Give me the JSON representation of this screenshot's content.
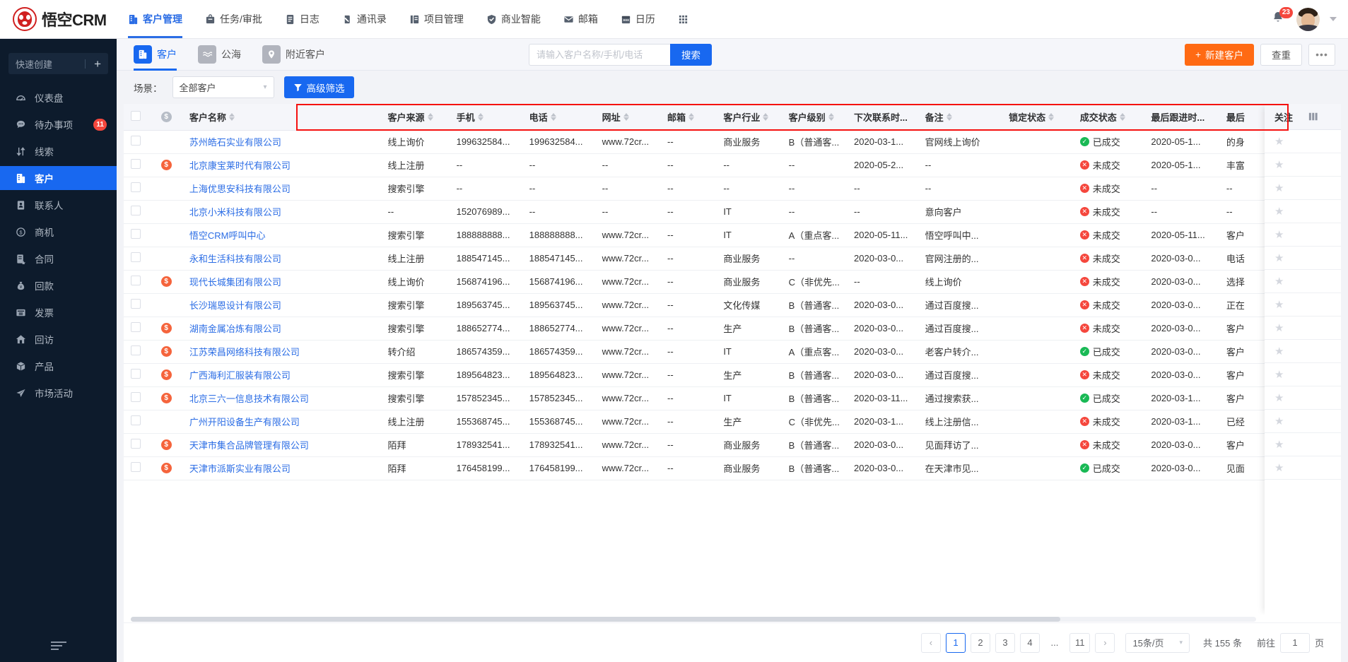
{
  "app": {
    "brand": "悟空CRM",
    "logo_color": "#d02020"
  },
  "topnav": {
    "items": [
      {
        "label": "客户管理",
        "icon": "customer-icon",
        "active": true
      },
      {
        "label": "任务/审批",
        "icon": "task-icon",
        "active": false
      },
      {
        "label": "日志",
        "icon": "log-icon",
        "active": false
      },
      {
        "label": "通讯录",
        "icon": "contacts-icon",
        "active": false
      },
      {
        "label": "项目管理",
        "icon": "project-icon",
        "active": false
      },
      {
        "label": "商业智能",
        "icon": "bi-icon",
        "active": false
      },
      {
        "label": "邮箱",
        "icon": "mail-icon",
        "active": false
      },
      {
        "label": "日历",
        "icon": "calendar-icon",
        "active": false
      }
    ],
    "apps_icon": "grid-apps-icon",
    "notification_count": "23",
    "avatar": "user-avatar"
  },
  "sidebar": {
    "quick_create": "快速创建",
    "quick_create_plus": "+",
    "items": [
      {
        "label": "仪表盘",
        "icon": "dashboard-icon",
        "active": false,
        "badge": ""
      },
      {
        "label": "待办事项",
        "icon": "todo-icon",
        "active": false,
        "badge": "11"
      },
      {
        "label": "线索",
        "icon": "clue-icon",
        "active": false,
        "badge": ""
      },
      {
        "label": "客户",
        "icon": "customer-icon",
        "active": true,
        "badge": ""
      },
      {
        "label": "联系人",
        "icon": "contact-person-icon",
        "active": false,
        "badge": ""
      },
      {
        "label": "商机",
        "icon": "business-opportunity-icon",
        "active": false,
        "badge": ""
      },
      {
        "label": "合同",
        "icon": "contract-icon",
        "active": false,
        "badge": ""
      },
      {
        "label": "回款",
        "icon": "receivable-icon",
        "active": false,
        "badge": ""
      },
      {
        "label": "发票",
        "icon": "invoice-icon",
        "active": false,
        "badge": ""
      },
      {
        "label": "回访",
        "icon": "revisit-icon",
        "active": false,
        "badge": ""
      },
      {
        "label": "产品",
        "icon": "product-icon",
        "active": false,
        "badge": ""
      },
      {
        "label": "市场活动",
        "icon": "marketing-icon",
        "active": false,
        "badge": ""
      }
    ]
  },
  "subtabs": [
    {
      "label": "客户",
      "icon": "customer-icon",
      "active": true
    },
    {
      "label": "公海",
      "icon": "pool-icon",
      "active": false
    },
    {
      "label": "附近客户",
      "icon": "location-icon",
      "active": false
    }
  ],
  "search": {
    "placeholder": "请输入客户名称/手机/电话",
    "value": "",
    "button": "搜索"
  },
  "actions": {
    "new_customer": "新建客户",
    "new_customer_plus": "+",
    "duplicate_check": "查重",
    "more": "•••"
  },
  "filter": {
    "scene_label": "场景：",
    "scene_value": "全部客户",
    "advanced": "高级筛选"
  },
  "table": {
    "columns": [
      {
        "key": "name",
        "label": "客户名称",
        "sortable": true
      },
      {
        "key": "source",
        "label": "客户来源",
        "sortable": true
      },
      {
        "key": "mobile",
        "label": "手机",
        "sortable": true
      },
      {
        "key": "tel",
        "label": "电话",
        "sortable": true
      },
      {
        "key": "web",
        "label": "网址",
        "sortable": true
      },
      {
        "key": "mail",
        "label": "邮箱",
        "sortable": true
      },
      {
        "key": "ind",
        "label": "客户行业",
        "sortable": true
      },
      {
        "key": "lvl",
        "label": "客户级别",
        "sortable": true
      },
      {
        "key": "next",
        "label": "下次联系时...",
        "sortable": false
      },
      {
        "key": "note",
        "label": "备注",
        "sortable": true
      },
      {
        "key": "lock",
        "label": "锁定状态",
        "sortable": true
      },
      {
        "key": "deal",
        "label": "成交状态",
        "sortable": true
      },
      {
        "key": "last",
        "label": "最后跟进时...",
        "sortable": false
      },
      {
        "key": "last2",
        "label": "最后",
        "sortable": false
      }
    ],
    "follow_column": "关注",
    "settings_icon": "column-settings-icon",
    "rows": [
      {
        "flag": false,
        "name": "苏州皓石实业有限公司",
        "source": "线上询价",
        "mobile": "199632584...",
        "tel": "199632584...",
        "web": "www.72cr...",
        "mail": "--",
        "ind": "商业服务",
        "lvl": "B（普通客...",
        "next": "2020-03-1...",
        "note": "官网线上询价",
        "lock": "",
        "deal": "已成交",
        "deal_state": "ok",
        "last": "2020-05-1...",
        "last2": "的身"
      },
      {
        "flag": true,
        "name": "北京康宝莱时代有限公司",
        "source": "线上注册",
        "mobile": "--",
        "tel": "--",
        "web": "--",
        "mail": "--",
        "ind": "--",
        "lvl": "--",
        "next": "2020-05-2...",
        "note": "--",
        "lock": "",
        "deal": "未成交",
        "deal_state": "no",
        "last": "2020-05-1...",
        "last2": "丰富"
      },
      {
        "flag": false,
        "name": "上海优思安科技有限公司",
        "source": "搜索引擎",
        "mobile": "--",
        "tel": "--",
        "web": "--",
        "mail": "--",
        "ind": "--",
        "lvl": "--",
        "next": "--",
        "note": "--",
        "lock": "",
        "deal": "未成交",
        "deal_state": "no",
        "last": "--",
        "last2": "--"
      },
      {
        "flag": false,
        "name": "北京小米科技有限公司",
        "source": "--",
        "mobile": "152076989...",
        "tel": "--",
        "web": "--",
        "mail": "--",
        "ind": "IT",
        "lvl": "--",
        "next": "--",
        "note": "意向客户",
        "lock": "",
        "deal": "未成交",
        "deal_state": "no",
        "last": "--",
        "last2": "--"
      },
      {
        "flag": false,
        "name": "悟空CRM呼叫中心",
        "source": "搜索引擎",
        "mobile": "188888888...",
        "tel": "188888888...",
        "web": "www.72cr...",
        "mail": "--",
        "ind": "IT",
        "lvl": "A（重点客...",
        "next": "2020-05-11...",
        "note": "悟空呼叫中...",
        "lock": "",
        "deal": "未成交",
        "deal_state": "no",
        "last": "2020-05-11...",
        "last2": "客户"
      },
      {
        "flag": false,
        "name": "永和生活科技有限公司",
        "source": "线上注册",
        "mobile": "188547145...",
        "tel": "188547145...",
        "web": "www.72cr...",
        "mail": "--",
        "ind": "商业服务",
        "lvl": "--",
        "next": "2020-03-0...",
        "note": "官网注册的...",
        "lock": "",
        "deal": "未成交",
        "deal_state": "no",
        "last": "2020-03-0...",
        "last2": "电话"
      },
      {
        "flag": true,
        "name": "现代长城集团有限公司",
        "source": "线上询价",
        "mobile": "156874196...",
        "tel": "156874196...",
        "web": "www.72cr...",
        "mail": "--",
        "ind": "商业服务",
        "lvl": "C（非优先...",
        "next": "--",
        "note": "线上询价",
        "lock": "",
        "deal": "未成交",
        "deal_state": "no",
        "last": "2020-03-0...",
        "last2": "选择"
      },
      {
        "flag": false,
        "name": "长沙瑞恩设计有限公司",
        "source": "搜索引擎",
        "mobile": "189563745...",
        "tel": "189563745...",
        "web": "www.72cr...",
        "mail": "--",
        "ind": "文化传媒",
        "lvl": "B（普通客...",
        "next": "2020-03-0...",
        "note": "通过百度搜...",
        "lock": "",
        "deal": "未成交",
        "deal_state": "no",
        "last": "2020-03-0...",
        "last2": "正在"
      },
      {
        "flag": true,
        "name": "湖南金属冶炼有限公司",
        "source": "搜索引擎",
        "mobile": "188652774...",
        "tel": "188652774...",
        "web": "www.72cr...",
        "mail": "--",
        "ind": "生产",
        "lvl": "B（普通客...",
        "next": "2020-03-0...",
        "note": "通过百度搜...",
        "lock": "",
        "deal": "未成交",
        "deal_state": "no",
        "last": "2020-03-0...",
        "last2": "客户"
      },
      {
        "flag": true,
        "name": "江苏荣昌网络科技有限公司",
        "source": "转介绍",
        "mobile": "186574359...",
        "tel": "186574359...",
        "web": "www.72cr...",
        "mail": "--",
        "ind": "IT",
        "lvl": "A（重点客...",
        "next": "2020-03-0...",
        "note": "老客户转介...",
        "lock": "",
        "deal": "已成交",
        "deal_state": "ok",
        "last": "2020-03-0...",
        "last2": "客户"
      },
      {
        "flag": true,
        "name": "广西海利汇服装有限公司",
        "source": "搜索引擎",
        "mobile": "189564823...",
        "tel": "189564823...",
        "web": "www.72cr...",
        "mail": "--",
        "ind": "生产",
        "lvl": "B（普通客...",
        "next": "2020-03-0...",
        "note": "通过百度搜...",
        "lock": "",
        "deal": "未成交",
        "deal_state": "no",
        "last": "2020-03-0...",
        "last2": "客户"
      },
      {
        "flag": true,
        "name": "北京三六一信息技术有限公司",
        "source": "搜索引擎",
        "mobile": "157852345...",
        "tel": "157852345...",
        "web": "www.72cr...",
        "mail": "--",
        "ind": "IT",
        "lvl": "B（普通客...",
        "next": "2020-03-11...",
        "note": "通过搜索获...",
        "lock": "",
        "deal": "已成交",
        "deal_state": "ok",
        "last": "2020-03-1...",
        "last2": "客户"
      },
      {
        "flag": false,
        "name": "广州开阳设备生产有限公司",
        "source": "线上注册",
        "mobile": "155368745...",
        "tel": "155368745...",
        "web": "www.72cr...",
        "mail": "--",
        "ind": "生产",
        "lvl": "C（非优先...",
        "next": "2020-03-1...",
        "note": "线上注册信...",
        "lock": "",
        "deal": "未成交",
        "deal_state": "no",
        "last": "2020-03-1...",
        "last2": "已经"
      },
      {
        "flag": true,
        "name": "天津市集合品牌管理有限公司",
        "source": "陌拜",
        "mobile": "178932541...",
        "tel": "178932541...",
        "web": "www.72cr...",
        "mail": "--",
        "ind": "商业服务",
        "lvl": "B（普通客...",
        "next": "2020-03-0...",
        "note": "见面拜访了...",
        "lock": "",
        "deal": "未成交",
        "deal_state": "no",
        "last": "2020-03-0...",
        "last2": "客户"
      },
      {
        "flag": true,
        "name": "天津市派斯实业有限公司",
        "source": "陌拜",
        "mobile": "176458199...",
        "tel": "176458199...",
        "web": "www.72cr...",
        "mail": "--",
        "ind": "商业服务",
        "lvl": "B（普通客...",
        "next": "2020-03-0...",
        "note": "在天津市见...",
        "lock": "",
        "deal": "已成交",
        "deal_state": "ok",
        "last": "2020-03-0...",
        "last2": "见面"
      }
    ]
  },
  "pagination": {
    "prev": "‹",
    "next": "›",
    "pages": [
      "1",
      "2",
      "3",
      "4",
      "...",
      "11"
    ],
    "current": "1",
    "page_size": "15条/页",
    "total_text": "共 155 条",
    "goto_label": "前往",
    "goto_value": "1",
    "goto_suffix": "页"
  }
}
